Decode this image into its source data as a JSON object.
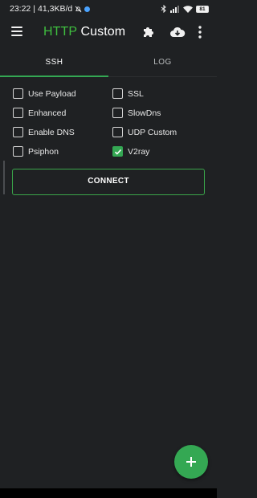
{
  "status_bar": {
    "time": "23:22",
    "speed": "41,3KB/d",
    "battery": "81"
  },
  "app_bar": {
    "title_part1": "HTTP",
    "title_part2": "Custom",
    "accent_color": "#34a853",
    "icons": [
      "menu-icon",
      "puzzle-icon",
      "cloud-download-icon",
      "more-vert-icon"
    ]
  },
  "tabs": [
    {
      "label": "SSH",
      "active": true
    },
    {
      "label": "LOG",
      "active": false
    }
  ],
  "options": [
    {
      "label": "Use Payload",
      "checked": false
    },
    {
      "label": "SSL",
      "checked": false
    },
    {
      "label": "Enhanced",
      "checked": false
    },
    {
      "label": "SlowDns",
      "checked": false
    },
    {
      "label": "Enable DNS",
      "checked": false
    },
    {
      "label": "UDP Custom",
      "checked": false
    },
    {
      "label": "Psiphon",
      "checked": false
    },
    {
      "label": "V2ray",
      "checked": true
    }
  ],
  "connect_label": "CONNECT",
  "fab_icon": "plus-icon"
}
